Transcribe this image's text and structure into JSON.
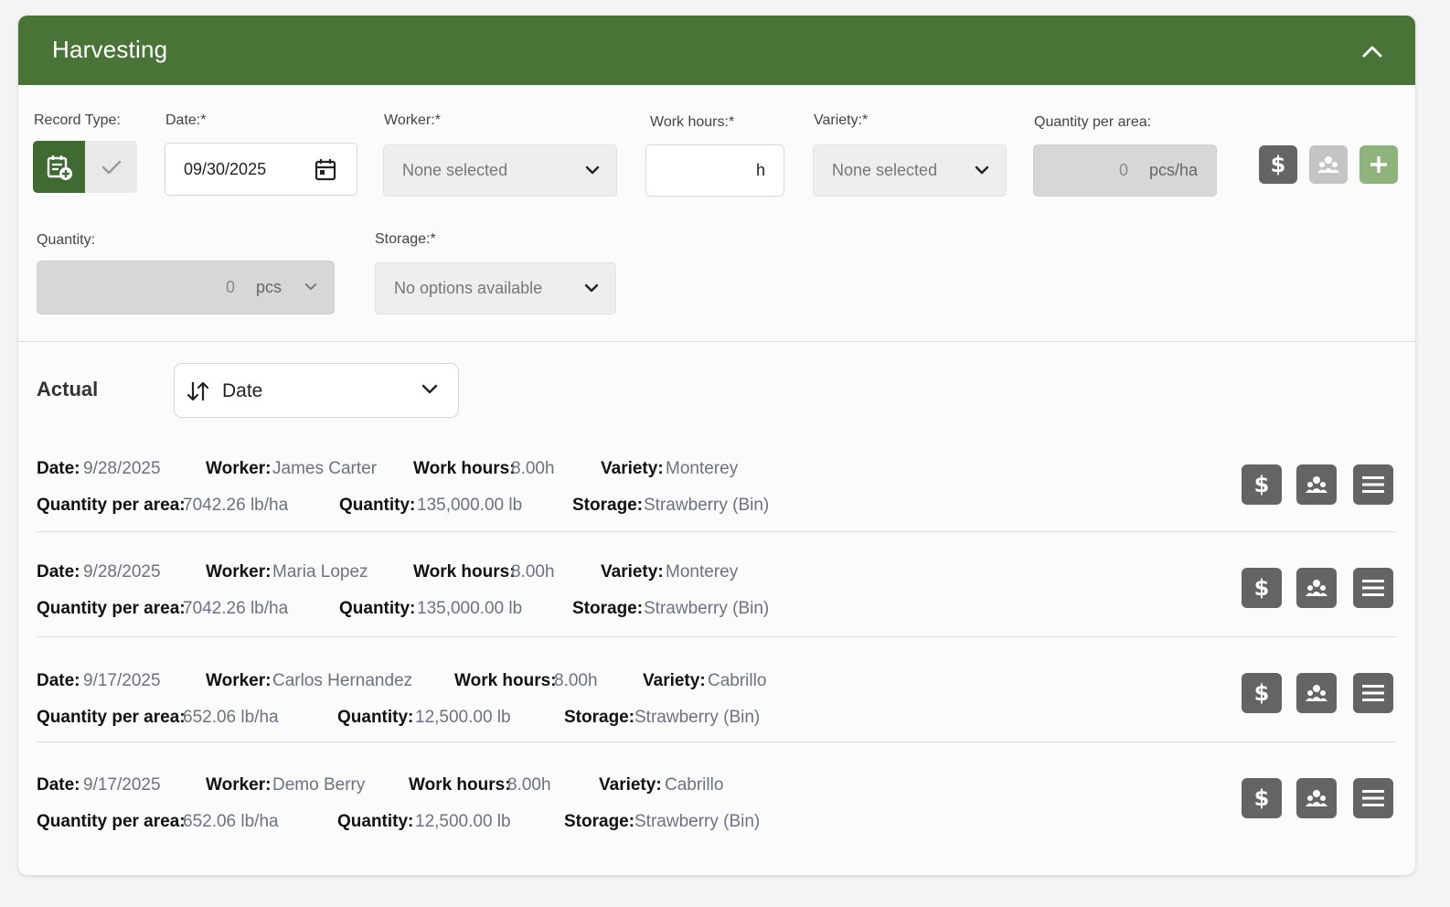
{
  "header": {
    "title": "Harvesting"
  },
  "form": {
    "record_type_label": "Record Type:",
    "date_label": "Date:*",
    "date_value": "09/30/2025",
    "worker_label": "Worker:*",
    "worker_value": "None selected",
    "work_hours_label": "Work hours:*",
    "work_hours_value": "",
    "work_hours_unit": "h",
    "variety_label": "Variety:*",
    "variety_value": "None selected",
    "qpa_label": "Quantity per area:",
    "qpa_value": "0",
    "qpa_unit": "pcs/ha",
    "quantity_label": "Quantity:",
    "quantity_value": "0",
    "quantity_unit": "pcs",
    "storage_label": "Storage:*",
    "storage_value": "No options available"
  },
  "actual": {
    "title": "Actual",
    "sort_value": "Date"
  },
  "labels": {
    "date": "Date:",
    "worker": "Worker:",
    "work_hours": "Work hours:",
    "variety": "Variety:",
    "qpa": "Quantity per area:",
    "quantity": "Quantity:",
    "storage": "Storage:"
  },
  "records": [
    {
      "date": "9/28/2025",
      "worker": "James Carter",
      "work_hours": "8.00h",
      "variety": "Monterey",
      "qpa": "7042.26 lb/ha",
      "quantity": "135,000.00 lb",
      "storage": "Strawberry (Bin)"
    },
    {
      "date": "9/28/2025",
      "worker": "Maria Lopez",
      "work_hours": "8.00h",
      "variety": "Monterey",
      "qpa": "7042.26 lb/ha",
      "quantity": "135,000.00 lb",
      "storage": "Strawberry (Bin)"
    },
    {
      "date": "9/17/2025",
      "worker": "Carlos Hernandez",
      "work_hours": "8.00h",
      "variety": "Cabrillo",
      "qpa": "652.06 lb/ha",
      "quantity": "12,500.00 lb",
      "storage": "Strawberry (Bin)"
    },
    {
      "date": "9/17/2025",
      "worker": "Demo Berry",
      "work_hours": "8.00h",
      "variety": "Cabrillo",
      "qpa": "652.06 lb/ha",
      "quantity": "12,500.00 lb",
      "storage": "Strawberry (Bin)"
    }
  ],
  "icons": {
    "cost": "dollar-icon",
    "workers": "people-icon",
    "menu": "hamburger-icon",
    "add": "plus-icon"
  },
  "colors": {
    "header_bg": "#4a7437",
    "accent_green": "#3f6b32",
    "value_text": "#6b7280",
    "icon_button": "#646464"
  }
}
